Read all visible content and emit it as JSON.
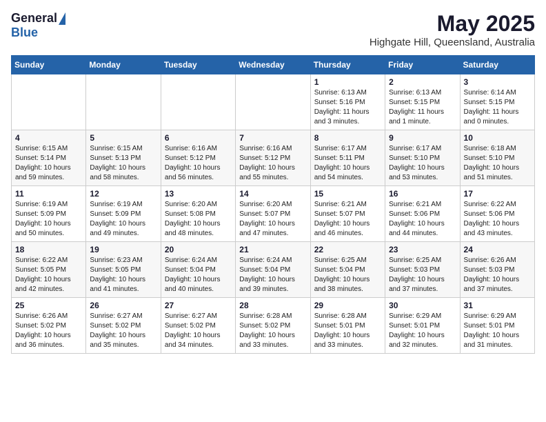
{
  "header": {
    "logo_general": "General",
    "logo_blue": "Blue",
    "month": "May 2025",
    "location": "Highgate Hill, Queensland, Australia"
  },
  "days_of_week": [
    "Sunday",
    "Monday",
    "Tuesday",
    "Wednesday",
    "Thursday",
    "Friday",
    "Saturday"
  ],
  "weeks": [
    [
      {
        "day": "",
        "info": ""
      },
      {
        "day": "",
        "info": ""
      },
      {
        "day": "",
        "info": ""
      },
      {
        "day": "",
        "info": ""
      },
      {
        "day": "1",
        "info": "Sunrise: 6:13 AM\nSunset: 5:16 PM\nDaylight: 11 hours\nand 3 minutes."
      },
      {
        "day": "2",
        "info": "Sunrise: 6:13 AM\nSunset: 5:15 PM\nDaylight: 11 hours\nand 1 minute."
      },
      {
        "day": "3",
        "info": "Sunrise: 6:14 AM\nSunset: 5:15 PM\nDaylight: 11 hours\nand 0 minutes."
      }
    ],
    [
      {
        "day": "4",
        "info": "Sunrise: 6:15 AM\nSunset: 5:14 PM\nDaylight: 10 hours\nand 59 minutes."
      },
      {
        "day": "5",
        "info": "Sunrise: 6:15 AM\nSunset: 5:13 PM\nDaylight: 10 hours\nand 58 minutes."
      },
      {
        "day": "6",
        "info": "Sunrise: 6:16 AM\nSunset: 5:12 PM\nDaylight: 10 hours\nand 56 minutes."
      },
      {
        "day": "7",
        "info": "Sunrise: 6:16 AM\nSunset: 5:12 PM\nDaylight: 10 hours\nand 55 minutes."
      },
      {
        "day": "8",
        "info": "Sunrise: 6:17 AM\nSunset: 5:11 PM\nDaylight: 10 hours\nand 54 minutes."
      },
      {
        "day": "9",
        "info": "Sunrise: 6:17 AM\nSunset: 5:10 PM\nDaylight: 10 hours\nand 53 minutes."
      },
      {
        "day": "10",
        "info": "Sunrise: 6:18 AM\nSunset: 5:10 PM\nDaylight: 10 hours\nand 51 minutes."
      }
    ],
    [
      {
        "day": "11",
        "info": "Sunrise: 6:19 AM\nSunset: 5:09 PM\nDaylight: 10 hours\nand 50 minutes."
      },
      {
        "day": "12",
        "info": "Sunrise: 6:19 AM\nSunset: 5:09 PM\nDaylight: 10 hours\nand 49 minutes."
      },
      {
        "day": "13",
        "info": "Sunrise: 6:20 AM\nSunset: 5:08 PM\nDaylight: 10 hours\nand 48 minutes."
      },
      {
        "day": "14",
        "info": "Sunrise: 6:20 AM\nSunset: 5:07 PM\nDaylight: 10 hours\nand 47 minutes."
      },
      {
        "day": "15",
        "info": "Sunrise: 6:21 AM\nSunset: 5:07 PM\nDaylight: 10 hours\nand 46 minutes."
      },
      {
        "day": "16",
        "info": "Sunrise: 6:21 AM\nSunset: 5:06 PM\nDaylight: 10 hours\nand 44 minutes."
      },
      {
        "day": "17",
        "info": "Sunrise: 6:22 AM\nSunset: 5:06 PM\nDaylight: 10 hours\nand 43 minutes."
      }
    ],
    [
      {
        "day": "18",
        "info": "Sunrise: 6:22 AM\nSunset: 5:05 PM\nDaylight: 10 hours\nand 42 minutes."
      },
      {
        "day": "19",
        "info": "Sunrise: 6:23 AM\nSunset: 5:05 PM\nDaylight: 10 hours\nand 41 minutes."
      },
      {
        "day": "20",
        "info": "Sunrise: 6:24 AM\nSunset: 5:04 PM\nDaylight: 10 hours\nand 40 minutes."
      },
      {
        "day": "21",
        "info": "Sunrise: 6:24 AM\nSunset: 5:04 PM\nDaylight: 10 hours\nand 39 minutes."
      },
      {
        "day": "22",
        "info": "Sunrise: 6:25 AM\nSunset: 5:04 PM\nDaylight: 10 hours\nand 38 minutes."
      },
      {
        "day": "23",
        "info": "Sunrise: 6:25 AM\nSunset: 5:03 PM\nDaylight: 10 hours\nand 37 minutes."
      },
      {
        "day": "24",
        "info": "Sunrise: 6:26 AM\nSunset: 5:03 PM\nDaylight: 10 hours\nand 37 minutes."
      }
    ],
    [
      {
        "day": "25",
        "info": "Sunrise: 6:26 AM\nSunset: 5:02 PM\nDaylight: 10 hours\nand 36 minutes."
      },
      {
        "day": "26",
        "info": "Sunrise: 6:27 AM\nSunset: 5:02 PM\nDaylight: 10 hours\nand 35 minutes."
      },
      {
        "day": "27",
        "info": "Sunrise: 6:27 AM\nSunset: 5:02 PM\nDaylight: 10 hours\nand 34 minutes."
      },
      {
        "day": "28",
        "info": "Sunrise: 6:28 AM\nSunset: 5:02 PM\nDaylight: 10 hours\nand 33 minutes."
      },
      {
        "day": "29",
        "info": "Sunrise: 6:28 AM\nSunset: 5:01 PM\nDaylight: 10 hours\nand 33 minutes."
      },
      {
        "day": "30",
        "info": "Sunrise: 6:29 AM\nSunset: 5:01 PM\nDaylight: 10 hours\nand 32 minutes."
      },
      {
        "day": "31",
        "info": "Sunrise: 6:29 AM\nSunset: 5:01 PM\nDaylight: 10 hours\nand 31 minutes."
      }
    ]
  ]
}
